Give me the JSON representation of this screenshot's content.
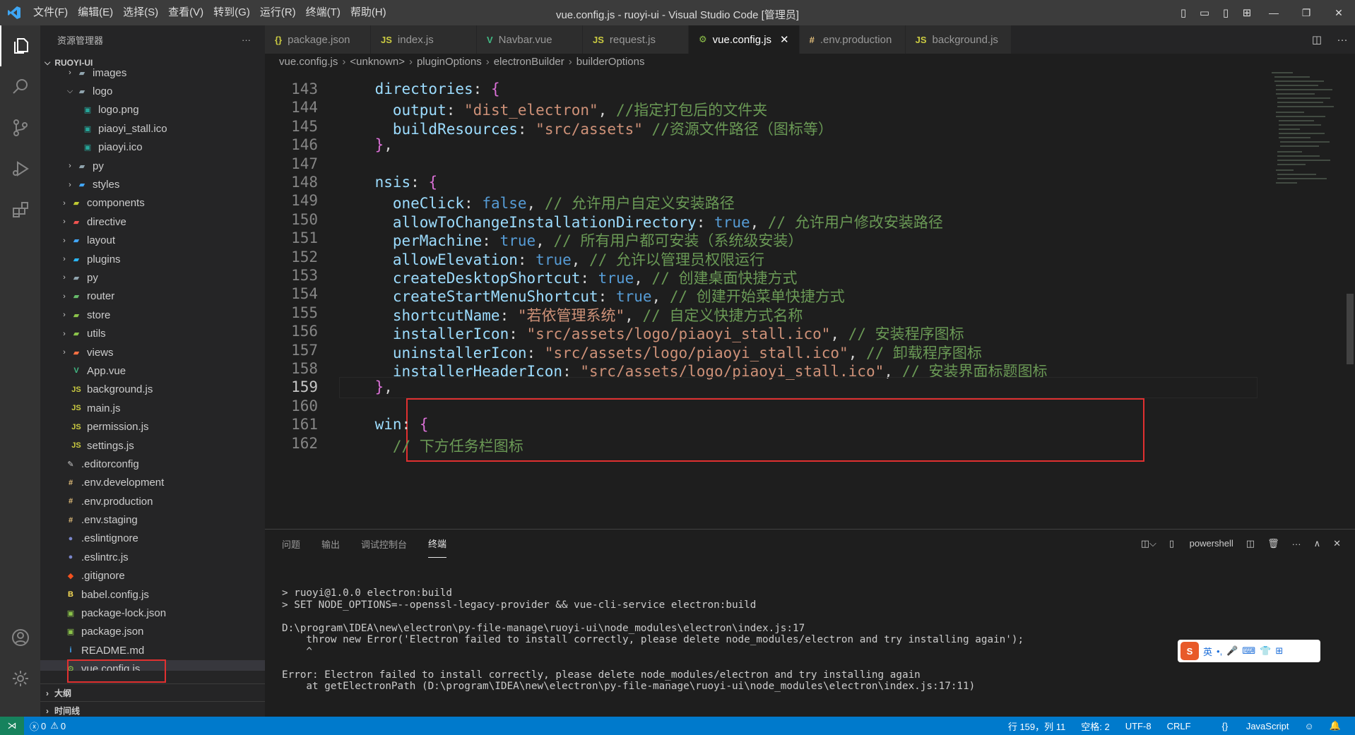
{
  "titlebar": {
    "menus": [
      "文件(F)",
      "编辑(E)",
      "选择(S)",
      "查看(V)",
      "转到(G)",
      "运行(R)",
      "终端(T)",
      "帮助(H)"
    ],
    "title": "vue.config.js - ruoyi-ui - Visual Studio Code [管理员]"
  },
  "sidebar": {
    "header": "资源管理器",
    "more": "···",
    "root": "RUOYI-UI",
    "items": [
      {
        "label": "images",
        "indent": 2,
        "kind": "folder",
        "open": false
      },
      {
        "label": "logo",
        "indent": 2,
        "kind": "folder",
        "open": true
      },
      {
        "label": "logo.png",
        "indent": 3,
        "kind": "img"
      },
      {
        "label": "piaoyi_stall.ico",
        "indent": 3,
        "kind": "img"
      },
      {
        "label": "piaoyi.ico",
        "indent": 3,
        "kind": "img"
      },
      {
        "label": "py",
        "indent": 2,
        "kind": "folder",
        "open": false
      },
      {
        "label": "styles",
        "indent": 2,
        "kind": "folder",
        "open": false
      },
      {
        "label": "components",
        "indent": 1,
        "kind": "folder",
        "open": false
      },
      {
        "label": "directive",
        "indent": 1,
        "kind": "folder",
        "open": false
      },
      {
        "label": "layout",
        "indent": 1,
        "kind": "folder",
        "open": false
      },
      {
        "label": "plugins",
        "indent": 1,
        "kind": "folder",
        "open": false
      },
      {
        "label": "py",
        "indent": 1,
        "kind": "folder",
        "open": false
      },
      {
        "label": "router",
        "indent": 1,
        "kind": "folder",
        "open": false
      },
      {
        "label": "store",
        "indent": 1,
        "kind": "folder",
        "open": false
      },
      {
        "label": "utils",
        "indent": 1,
        "kind": "folder",
        "open": false
      },
      {
        "label": "views",
        "indent": 1,
        "kind": "folder",
        "open": false
      },
      {
        "label": "App.vue",
        "indent": 1,
        "kind": "vue"
      },
      {
        "label": "background.js",
        "indent": 1,
        "kind": "js"
      },
      {
        "label": "main.js",
        "indent": 1,
        "kind": "js"
      },
      {
        "label": "permission.js",
        "indent": 1,
        "kind": "js"
      },
      {
        "label": "settings.js",
        "indent": 1,
        "kind": "js"
      },
      {
        "label": ".editorconfig",
        "indent": 0,
        "kind": "cfg"
      },
      {
        "label": ".env.development",
        "indent": 0,
        "kind": "env"
      },
      {
        "label": ".env.production",
        "indent": 0,
        "kind": "env"
      },
      {
        "label": ".env.staging",
        "indent": 0,
        "kind": "env"
      },
      {
        "label": ".eslintignore",
        "indent": 0,
        "kind": "eslint"
      },
      {
        "label": ".eslintrc.js",
        "indent": 0,
        "kind": "eslint"
      },
      {
        "label": ".gitignore",
        "indent": 0,
        "kind": "git"
      },
      {
        "label": "babel.config.js",
        "indent": 0,
        "kind": "babel"
      },
      {
        "label": "package-lock.json",
        "indent": 0,
        "kind": "npm"
      },
      {
        "label": "package.json",
        "indent": 0,
        "kind": "npm"
      },
      {
        "label": "README.md",
        "indent": 0,
        "kind": "info"
      },
      {
        "label": "vue.config.js",
        "indent": 0,
        "kind": "vuecfg",
        "selected": true
      }
    ],
    "outline": "大纲",
    "timeline": "时间线"
  },
  "tabs": [
    {
      "label": "package.json",
      "icon": "{}",
      "color": "#cbcb41"
    },
    {
      "label": "index.js",
      "icon": "JS",
      "color": "#cbcb41"
    },
    {
      "label": "Navbar.vue",
      "icon": "V",
      "color": "#41b883"
    },
    {
      "label": "request.js",
      "icon": "JS",
      "color": "#cbcb41"
    },
    {
      "label": "vue.config.js",
      "icon": "⚙",
      "color": "#8dc149",
      "active": true
    },
    {
      "label": ".env.production",
      "icon": "#",
      "color": "#e5c07b"
    },
    {
      "label": "background.js",
      "icon": "JS",
      "color": "#cbcb41"
    }
  ],
  "breadcrumbs": [
    "vue.config.js",
    "<unknown>",
    "pluginOptions",
    "electronBuilder",
    "builderOptions"
  ],
  "code": {
    "current_line": 159,
    "lines": [
      {
        "n": 143,
        "html": "    <span class='k'>directories</span>: <span class='pp'>{</span>"
      },
      {
        "n": 144,
        "html": "      <span class='k'>output</span>: <span class='s'>\"dist_electron\"</span>, <span class='c'>//指定打包后的文件夹</span>"
      },
      {
        "n": 145,
        "html": "      <span class='k'>buildResources</span>: <span class='s'>\"src/assets\"</span> <span class='c'>//资源文件路径（图标等）</span>"
      },
      {
        "n": 146,
        "html": "    <span class='pp'>}</span>,"
      },
      {
        "n": 147,
        "html": ""
      },
      {
        "n": 148,
        "html": "    <span class='k'>nsis</span>: <span class='pp'>{</span>"
      },
      {
        "n": 149,
        "html": "      <span class='k'>oneClick</span>: <span class='b'>false</span>, <span class='c'>// 允许用户自定义安装路径</span>"
      },
      {
        "n": 150,
        "html": "      <span class='k'>allowToChangeInstallationDirectory</span>: <span class='b'>true</span>, <span class='c'>// 允许用户修改安装路径</span>"
      },
      {
        "n": 151,
        "html": "      <span class='k'>perMachine</span>: <span class='b'>true</span>, <span class='c'>// 所有用户都可安装（系统级安装）</span>"
      },
      {
        "n": 152,
        "html": "      <span class='k'>allowElevation</span>: <span class='b'>true</span>, <span class='c'>// 允许以管理员权限运行</span>"
      },
      {
        "n": 153,
        "html": "      <span class='k'>createDesktopShortcut</span>: <span class='b'>true</span>, <span class='c'>// 创建桌面快捷方式</span>"
      },
      {
        "n": 154,
        "html": "      <span class='k'>createStartMenuShortcut</span>: <span class='b'>true</span>, <span class='c'>// 创建开始菜单快捷方式</span>"
      },
      {
        "n": 155,
        "html": "      <span class='k'>shortcutName</span>: <span class='s'>\"若依管理系统\"</span>, <span class='c'>// 自定义快捷方式名称</span>"
      },
      {
        "n": 156,
        "html": "      <span class='k'>installerIcon</span>: <span class='s'>\"src/assets/logo/piaoyi_stall.ico\"</span>, <span class='c'>// 安装程序图标</span>"
      },
      {
        "n": 157,
        "html": "      <span class='k'>uninstallerIcon</span>: <span class='s'>\"src/assets/logo/piaoyi_stall.ico\"</span>, <span class='c'>// 卸载程序图标</span>"
      },
      {
        "n": 158,
        "html": "      <span class='k'>installerHeaderIcon</span>: <span class='s'>\"src/assets/logo/piaoyi_stall.ico\"</span>, <span class='c'>// 安装界面标题图标</span>"
      },
      {
        "n": 159,
        "html": "    <span class='pp'>}</span>,"
      },
      {
        "n": 160,
        "html": ""
      },
      {
        "n": 161,
        "html": "    <span class='k'>win</span>: <span class='pp'>{</span>"
      },
      {
        "n": 162,
        "html": "      <span class='c'>// 下方任务栏图标</span>"
      }
    ]
  },
  "panel": {
    "tabs": [
      "问题",
      "输出",
      "调试控制台",
      "终端"
    ],
    "active_tab": "终端",
    "shell": "powershell",
    "terminal": [
      "> ruoyi@1.0.0 electron:build",
      "> SET NODE_OPTIONS=--openssl-legacy-provider && vue-cli-service electron:build",
      "",
      "D:\\program\\IDEA\\new\\electron\\py-file-manage\\ruoyi-ui\\node_modules\\electron\\index.js:17",
      "    throw new Error('Electron failed to install correctly, please delete node_modules/electron and try installing again');",
      "    ^",
      "",
      "Error: Electron failed to install correctly, please delete node_modules/electron and try installing again",
      "    at getElectronPath (D:\\program\\IDEA\\new\\electron\\py-file-manage\\ruoyi-ui\\node_modules\\electron\\index.js:17:11)"
    ]
  },
  "ime": {
    "logo": "S",
    "mode": "英"
  },
  "status": {
    "errors": "0",
    "warnings": "0",
    "position": "行 159，列 11",
    "spaces": "空格: 2",
    "encoding": "UTF-8",
    "eol": "CRLF",
    "language": "JavaScript"
  }
}
